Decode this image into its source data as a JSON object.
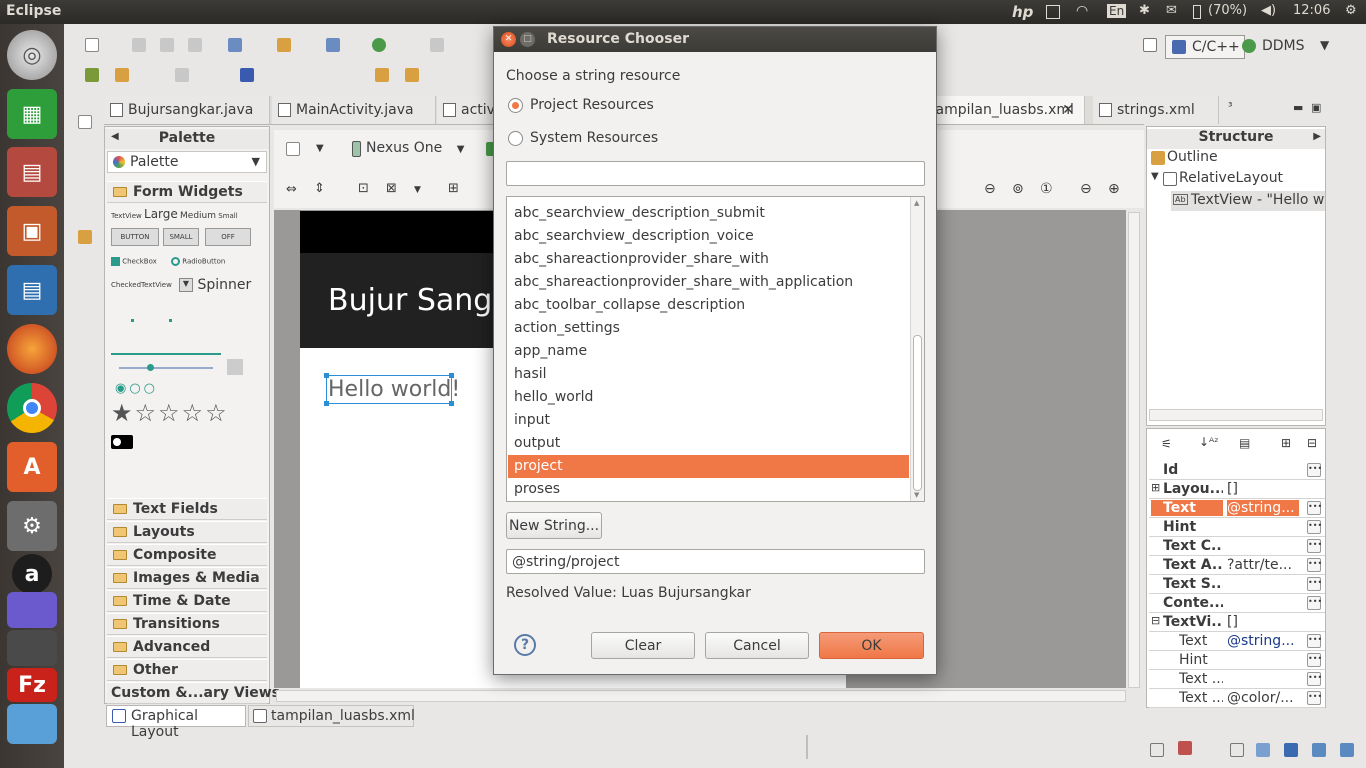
{
  "topbar": {
    "app_title": "Eclipse",
    "battery": "(70%)",
    "clock": "12:06",
    "keyboard": "En",
    "icons": [
      "hp-icon",
      "keyboard-layout-icon",
      "wifi-icon",
      "bluetooth-icon",
      "battery-icon",
      "volume-icon",
      "power-icon"
    ]
  },
  "launcher": {
    "items": [
      "ubuntu-dash-icon",
      "libreoffice-calc-icon",
      "file-manager-icon",
      "libreoffice-impress-icon",
      "libreoffice-writer-icon",
      "firefox-icon",
      "chrome-icon",
      "software-center-icon",
      "system-settings-icon",
      "amazon-icon",
      "mail-icon",
      "filezilla-icon",
      "trash-icon"
    ]
  },
  "perspectives": {
    "cpp": "C/C++",
    "ddms": "DDMS"
  },
  "editor_tabs": [
    {
      "label": "Bujursangkar.java"
    },
    {
      "label": "MainActivity.java"
    },
    {
      "label": "activ"
    },
    {
      "label": "tampilan_luasbs.xml"
    },
    {
      "label": "strings.xml"
    },
    {
      "label": "³"
    }
  ],
  "palette": {
    "header": "Palette",
    "dropdown": "Palette",
    "form_widgets": "Form Widgets",
    "tv_labels": [
      "TextView",
      "Large",
      "Medium",
      "Small"
    ],
    "buttons": [
      "BUTTON",
      "SMALL",
      "OFF"
    ],
    "checkbox": "CheckBox",
    "radiobutton": "RadioButton",
    "checkedtextview": "CheckedTextView",
    "spinner": "Spinner",
    "categories": [
      "Text Fields",
      "Layouts",
      "Composite",
      "Images & Media",
      "Time & Date",
      "Transitions",
      "Advanced",
      "Other",
      "Custom &...ary Views"
    ]
  },
  "layout_toolbar": {
    "device": "Nexus One"
  },
  "canvas": {
    "app_title": "Bujur Sang",
    "hello": "Hello world!"
  },
  "bottom_tabs": {
    "graphical": "Graphical Layout",
    "xml": "tampilan_luasbs.xml"
  },
  "structure": {
    "header": "Structure",
    "outline": "Outline",
    "tree": [
      "RelativeLayout",
      "TextView - \"Hello wo"
    ]
  },
  "properties": {
    "rows": [
      {
        "key": "Id",
        "value": ""
      },
      {
        "key": "Layou...",
        "value": "[]"
      },
      {
        "key": "Text",
        "value": "@string..."
      },
      {
        "key": "Hint",
        "value": ""
      },
      {
        "key": "Text C...",
        "value": ""
      },
      {
        "key": "Text A...",
        "value": "?attr/te..."
      },
      {
        "key": "Text S...",
        "value": ""
      },
      {
        "key": "Conte...",
        "value": ""
      },
      {
        "key": "TextVi...",
        "value": "[]"
      },
      {
        "key": "Text",
        "value": "@string..."
      },
      {
        "key": "Hint",
        "value": ""
      },
      {
        "key": "Text ...",
        "value": ""
      },
      {
        "key": "Text ...",
        "value": "@color/..."
      }
    ]
  },
  "dialog": {
    "title": "Resource Chooser",
    "prompt": "Choose a string resource",
    "radio_project": "Project Resources",
    "radio_system": "System Resources",
    "filter_value": "",
    "items": [
      "abc_searchview_description_submit",
      "abc_searchview_description_voice",
      "abc_shareactionprovider_share_with",
      "abc_shareactionprovider_share_with_application",
      "abc_toolbar_collapse_description",
      "action_settings",
      "app_name",
      "hasil",
      "hello_world",
      "input",
      "output",
      "project",
      "proses"
    ],
    "selected": "project",
    "new_string": "New String...",
    "value": "@string/project",
    "resolved": "Resolved Value: Luas Bujursangkar",
    "clear": "Clear",
    "cancel": "Cancel",
    "ok": "OK",
    "accent": "#f07746"
  }
}
